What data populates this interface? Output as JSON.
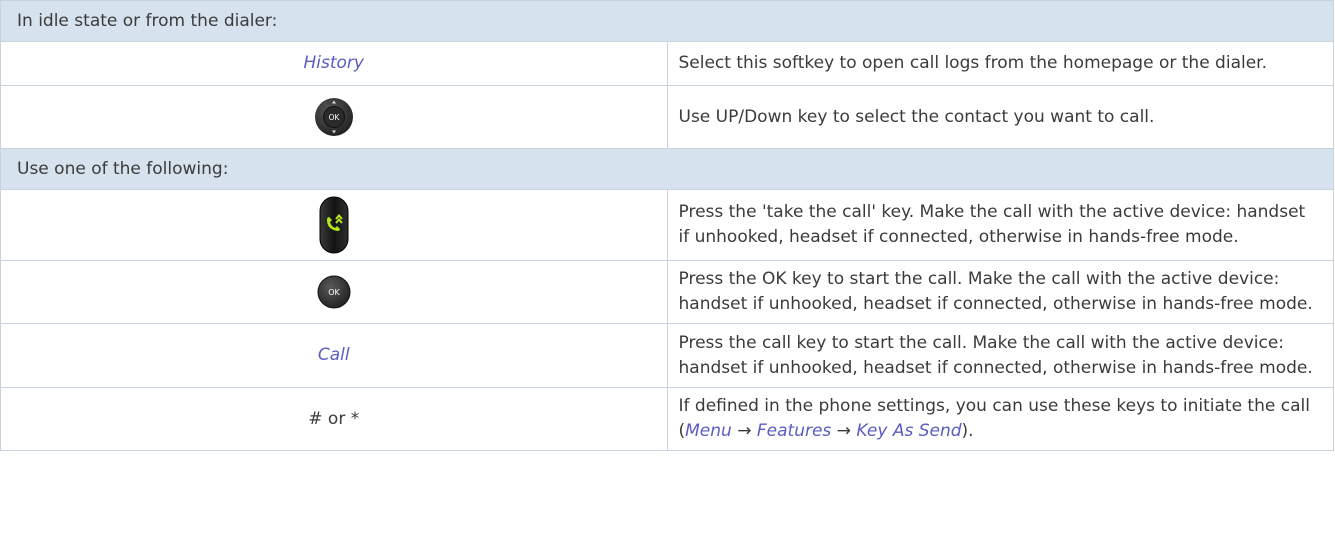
{
  "section_idle": "In idle state or from the dialer:",
  "section_use": "Use one of the following:",
  "rows": {
    "history": {
      "key": "History",
      "desc": "Select this softkey to open call logs from the homepage or the dialer."
    },
    "navigator": {
      "icon": "navigator-ok-key-icon",
      "icon_label": "OK",
      "desc": "Use UP/Down key to select the contact you want to call."
    },
    "take_call": {
      "icon": "take-call-key-icon",
      "desc": "Press the 'take the call' key. Make the call with the active device: handset if unhooked, headset if connected, otherwise in hands-free mode."
    },
    "ok": {
      "icon": "ok-key-icon",
      "icon_label": "OK",
      "desc": "Press the OK key to start the call. Make the call with the active device: handset if unhooked, headset if connected, otherwise in hands-free mode."
    },
    "call": {
      "key": "Call",
      "desc": "Press the call key to start the call. Make the call with the active device: handset if unhooked, headset if connected, otherwise in hands-free mode."
    },
    "hash": {
      "key": "# or *",
      "desc_before": "If defined in the phone settings, you can use these keys to initiate the call (",
      "menu": "Menu",
      "arrow": "→",
      "features": "Features",
      "key_as_send": "Key As Send",
      "desc_after": ")."
    }
  },
  "colors": {
    "header_bg": "#d6e2ee",
    "border": "#c8d3dd",
    "softkey_text": "#5a5cc0",
    "body_text": "#3b3b3b",
    "key_green": "#b5e61d"
  }
}
